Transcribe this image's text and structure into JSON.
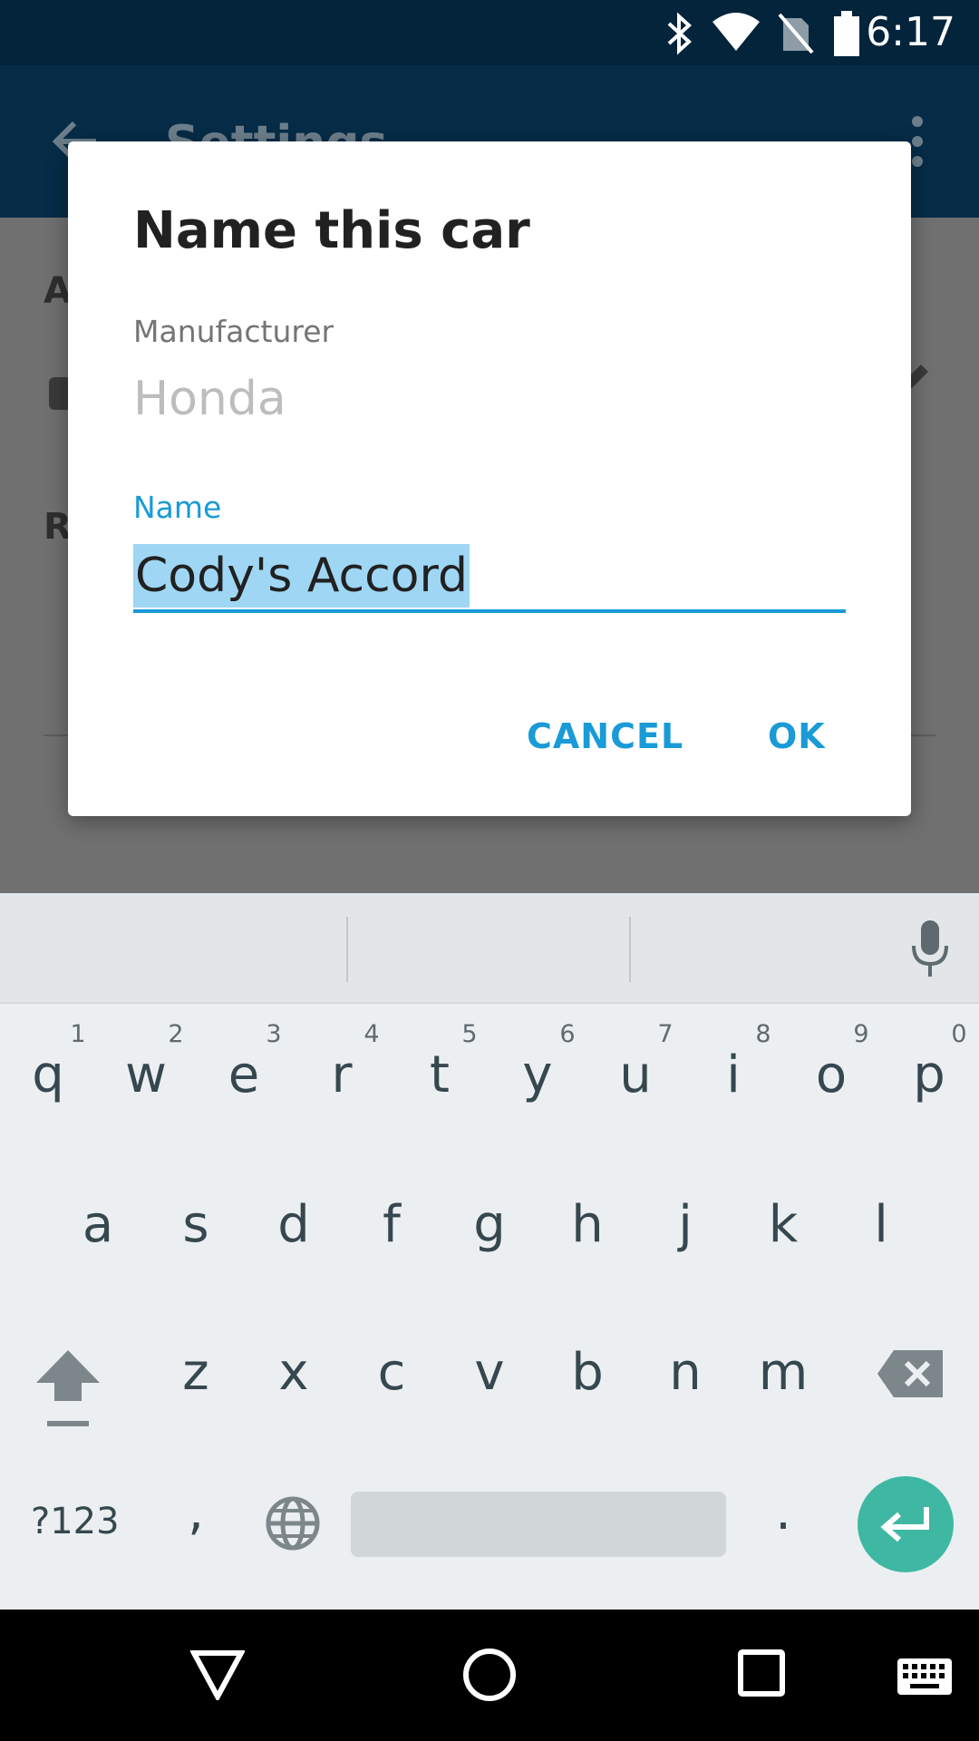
{
  "status_bar": {
    "time": "6:17"
  },
  "app_bar": {
    "title": "Settings"
  },
  "background": {
    "section_a": "A",
    "section_r": "R"
  },
  "dialog": {
    "title": "Name this car",
    "manufacturer_label": "Manufacturer",
    "manufacturer_value": "Honda",
    "name_label": "Name",
    "name_value": "Cody's Accord",
    "cancel_label": "CANCEL",
    "ok_label": "OK"
  },
  "keyboard": {
    "row1": [
      "q",
      "w",
      "e",
      "r",
      "t",
      "y",
      "u",
      "i",
      "o",
      "p"
    ],
    "row1_hints": [
      "1",
      "2",
      "3",
      "4",
      "5",
      "6",
      "7",
      "8",
      "9",
      "0"
    ],
    "row2": [
      "a",
      "s",
      "d",
      "f",
      "g",
      "h",
      "j",
      "k",
      "l"
    ],
    "row3": [
      "z",
      "x",
      "c",
      "v",
      "b",
      "n",
      "m"
    ],
    "symbols_label": "?123",
    "comma": ",",
    "period": "."
  },
  "colors": {
    "accent": "#1a9ad6",
    "enter": "#3fb8a3",
    "status_bar": "#03243b"
  }
}
